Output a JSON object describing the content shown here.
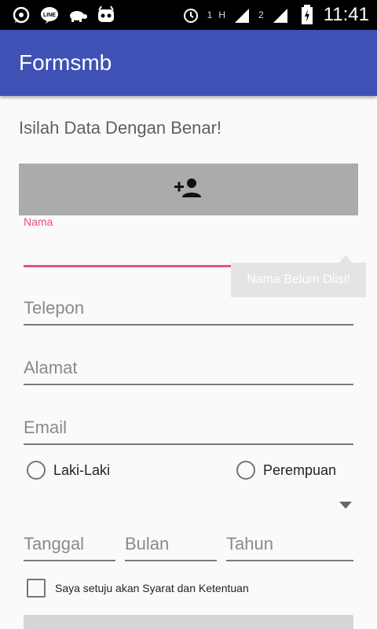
{
  "status_bar": {
    "time": "11:41",
    "sim1_label": "1",
    "sim1_net": "H",
    "sim2_label": "2",
    "icons": [
      "whatsapp-icon",
      "line-icon",
      "turtle-icon",
      "cyanogen-icon",
      "alarm-icon",
      "signal-icon",
      "battery-icon"
    ]
  },
  "app_bar": {
    "title": "Formsmb"
  },
  "form": {
    "heading": "Isilah Data Dengan Benar!",
    "photo_button_icon": "add-person-icon",
    "name": {
      "label": "Nama",
      "value": "",
      "error": "Nama Belum Diisi!"
    },
    "phone": {
      "placeholder": "Telepon"
    },
    "address": {
      "placeholder": "Alamat"
    },
    "email": {
      "placeholder": "Email"
    },
    "gender_options": [
      "Laki-Laki",
      "Perempuan"
    ],
    "date": {
      "day": "Tanggal",
      "month": "Bulan",
      "year": "Tahun"
    },
    "agree_label": "Saya setuju akan Syarat dan Ketentuan"
  },
  "colors": {
    "primary": "#3f51b5",
    "accent": "#e84e8a",
    "button_gray": "#ababab"
  }
}
